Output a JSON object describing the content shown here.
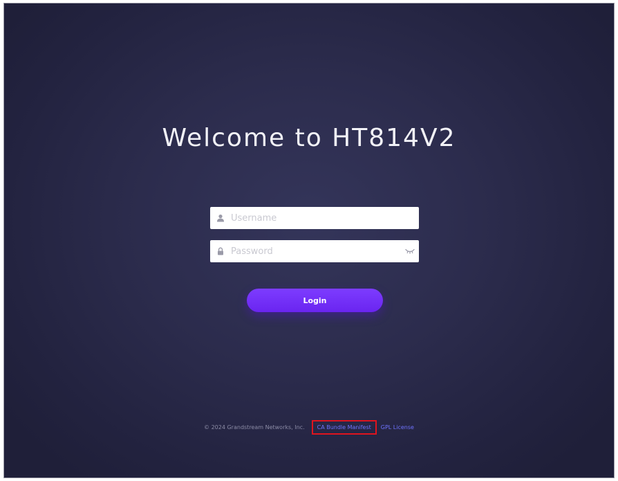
{
  "page": {
    "title": "Welcome to HT814V2"
  },
  "form": {
    "username": {
      "placeholder": "Username",
      "value": "",
      "icon": "user-icon"
    },
    "password": {
      "placeholder": "Password",
      "value": "",
      "icon": "lock-icon",
      "toggle_icon": "eye-closed-icon"
    },
    "login_label": "Login"
  },
  "footer": {
    "copyright": "© 2024 Grandstream Networks, Inc.",
    "ca_bundle_label": "CA Bundle Manifest",
    "gpl_label": "GPL License"
  },
  "colors": {
    "background": "#2c2c4d",
    "title_text": "#f2f2f7",
    "login_button": "#7d3cff",
    "link": "#6f73ff",
    "highlight_box": "#e0141e"
  }
}
